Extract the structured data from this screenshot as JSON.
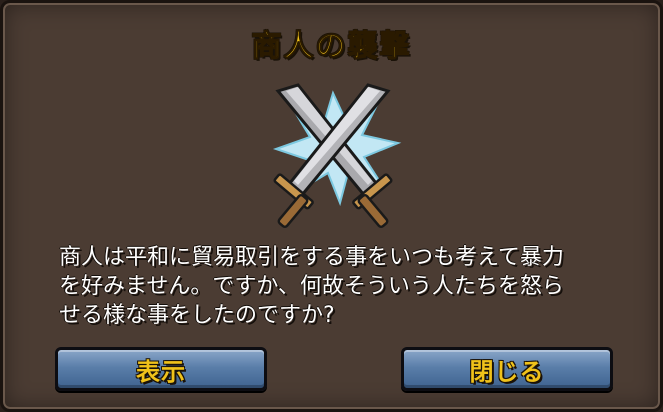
{
  "dialog": {
    "title": "商人の襲撃",
    "emblem_icon": "crossed-swords-icon",
    "message": "商人は平和に貿易取引をする事をいつも考えて暴力\nを好みません。ですか、何故そういう人たちを怒ら\nせる様な事をしたのですか?",
    "buttons": {
      "show_label": "表示",
      "close_label": "閉じる"
    }
  },
  "colors": {
    "panel": "#4b3c33",
    "title_gold": "#f0c21a",
    "button_blue": "#5a7ea9"
  }
}
